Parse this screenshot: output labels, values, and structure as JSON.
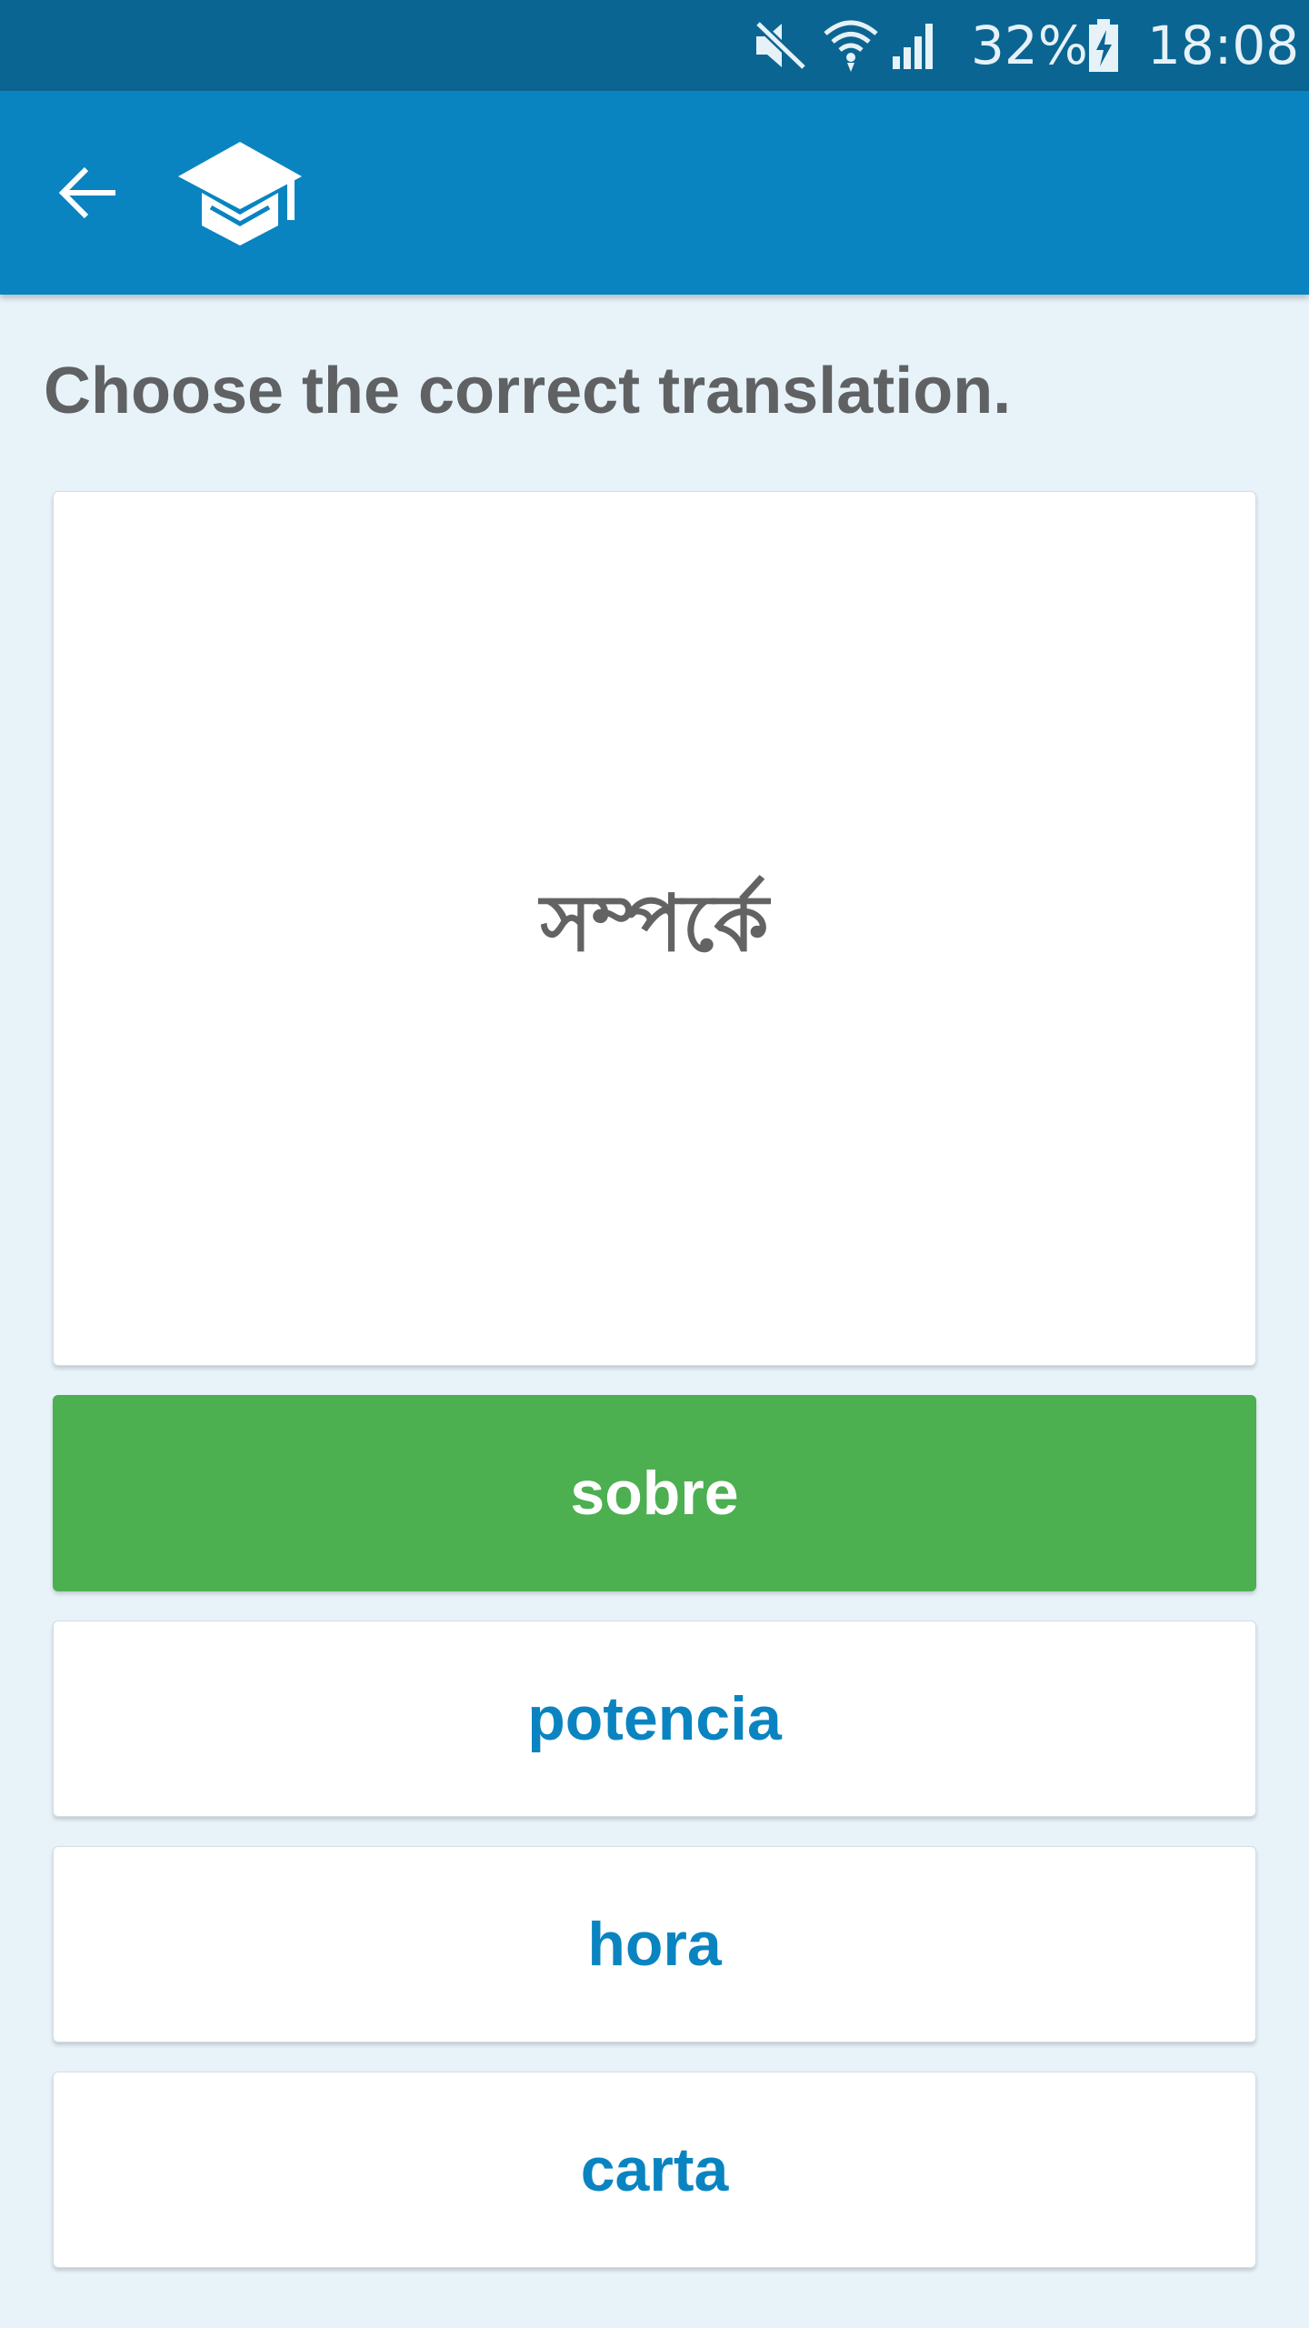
{
  "status_bar": {
    "battery_percent": "32%",
    "time": "18:08",
    "icons": [
      "mute-icon",
      "wifi-icon",
      "signal-icon",
      "battery-charging-icon"
    ]
  },
  "app_bar": {
    "back_icon": "back-arrow-icon",
    "logo_icon": "graduation-cap-icon",
    "background_color": "#0a84c1"
  },
  "quiz": {
    "instruction": "Choose the correct translation.",
    "word": "সম্পর্কে",
    "options": [
      {
        "label": "sobre",
        "state": "correct"
      },
      {
        "label": "potencia",
        "state": "default"
      },
      {
        "label": "hora",
        "state": "default"
      },
      {
        "label": "carta",
        "state": "default"
      }
    ],
    "correct_color": "#4caf50",
    "option_text_color": "#0a84c1"
  }
}
